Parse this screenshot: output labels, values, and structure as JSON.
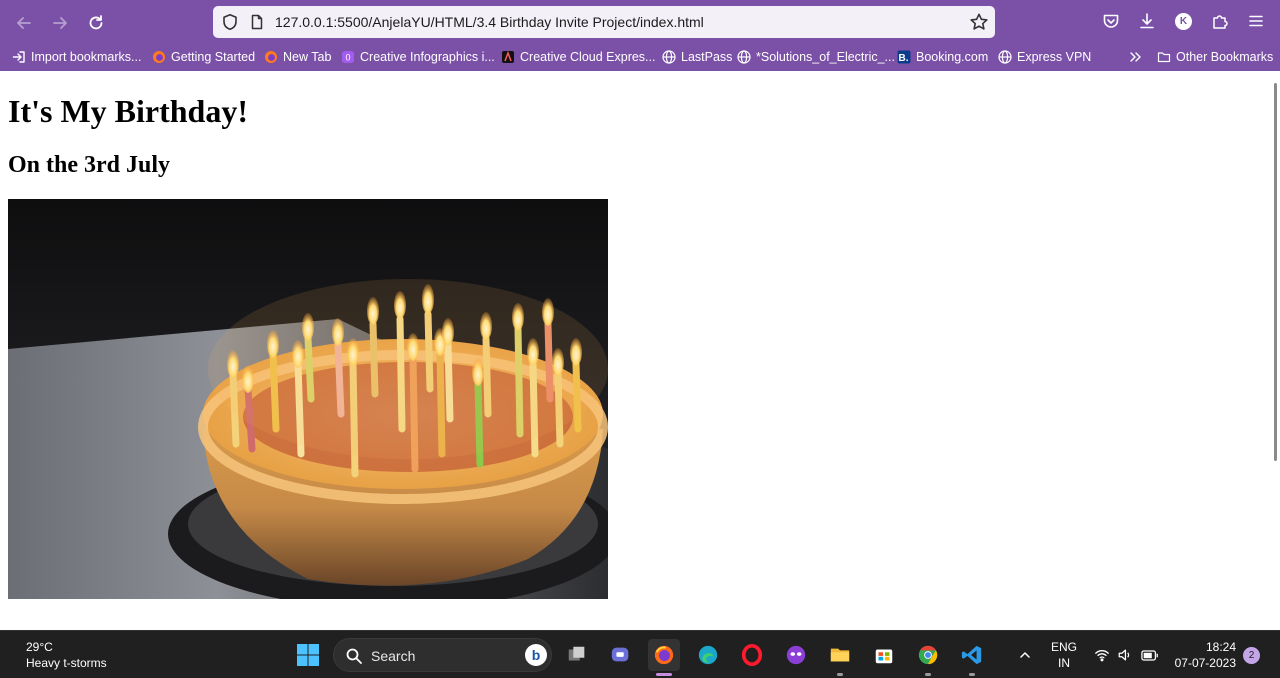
{
  "browser": {
    "url": "127.0.0.1:5500/AnjelaYU/HTML/3.4 Birthday Invite Project/index.html",
    "accent": "#7b51a8",
    "avatar_letter": "K"
  },
  "bookmarks": [
    {
      "label": "Import bookmarks...",
      "icon": "import-icon"
    },
    {
      "label": "Getting Started",
      "icon": "firefox-icon"
    },
    {
      "label": "New Tab",
      "icon": "firefox-icon"
    },
    {
      "label": "Creative Infographics i...",
      "icon": "creative-icon"
    },
    {
      "label": "Creative Cloud Expres...",
      "icon": "adobe-express-icon"
    },
    {
      "label": "LastPass",
      "icon": "globe-icon"
    },
    {
      "label": "*Solutions_of_Electric_...",
      "icon": "globe-icon"
    },
    {
      "label": "Booking.com",
      "icon": "booking-icon"
    },
    {
      "label": "Express VPN",
      "icon": "globe-icon"
    }
  ],
  "other_bookmarks": "Other Bookmarks",
  "page": {
    "heading": "It's My Birthday!",
    "subheading": "On the 3rd July"
  },
  "taskbar": {
    "weather_temp": "29°C",
    "weather_desc": "Heavy t-storms",
    "search_placeholder": "Search",
    "lang_top": "ENG",
    "lang_bottom": "IN",
    "time": "18:24",
    "date": "07-07-2023",
    "notifications": "2"
  }
}
